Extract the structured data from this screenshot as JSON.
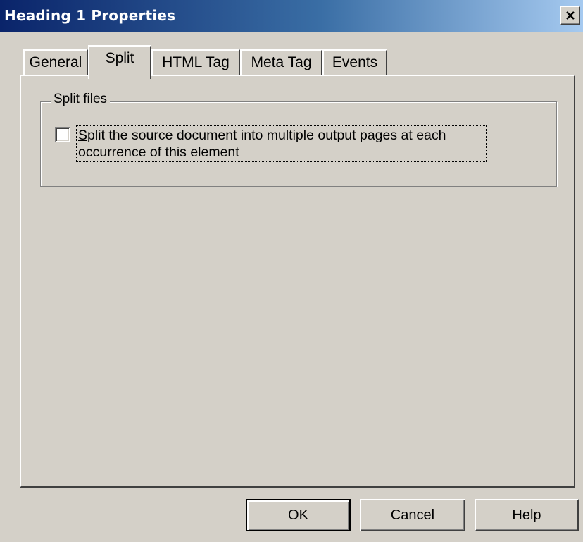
{
  "window": {
    "title": "Heading 1 Properties",
    "close_icon": "close-x-icon"
  },
  "tabs": [
    {
      "label": "General",
      "active": false
    },
    {
      "label": "Split",
      "active": true
    },
    {
      "label": "HTML Tag",
      "active": false
    },
    {
      "label": "Meta Tag",
      "active": false
    },
    {
      "label": "Events",
      "active": false
    }
  ],
  "split_files": {
    "group_label": "Split files",
    "checkbox_checked": false,
    "checkbox_label_mnemonic": "S",
    "checkbox_label_rest": "plit the source document into multiple output pages at each occurrence of this element"
  },
  "buttons": {
    "ok": "OK",
    "cancel": "Cancel",
    "help": "Help"
  },
  "colors": {
    "title_bar_start": "#0a246a",
    "title_bar_end": "#a6caf0",
    "face": "#d4d0c8"
  }
}
